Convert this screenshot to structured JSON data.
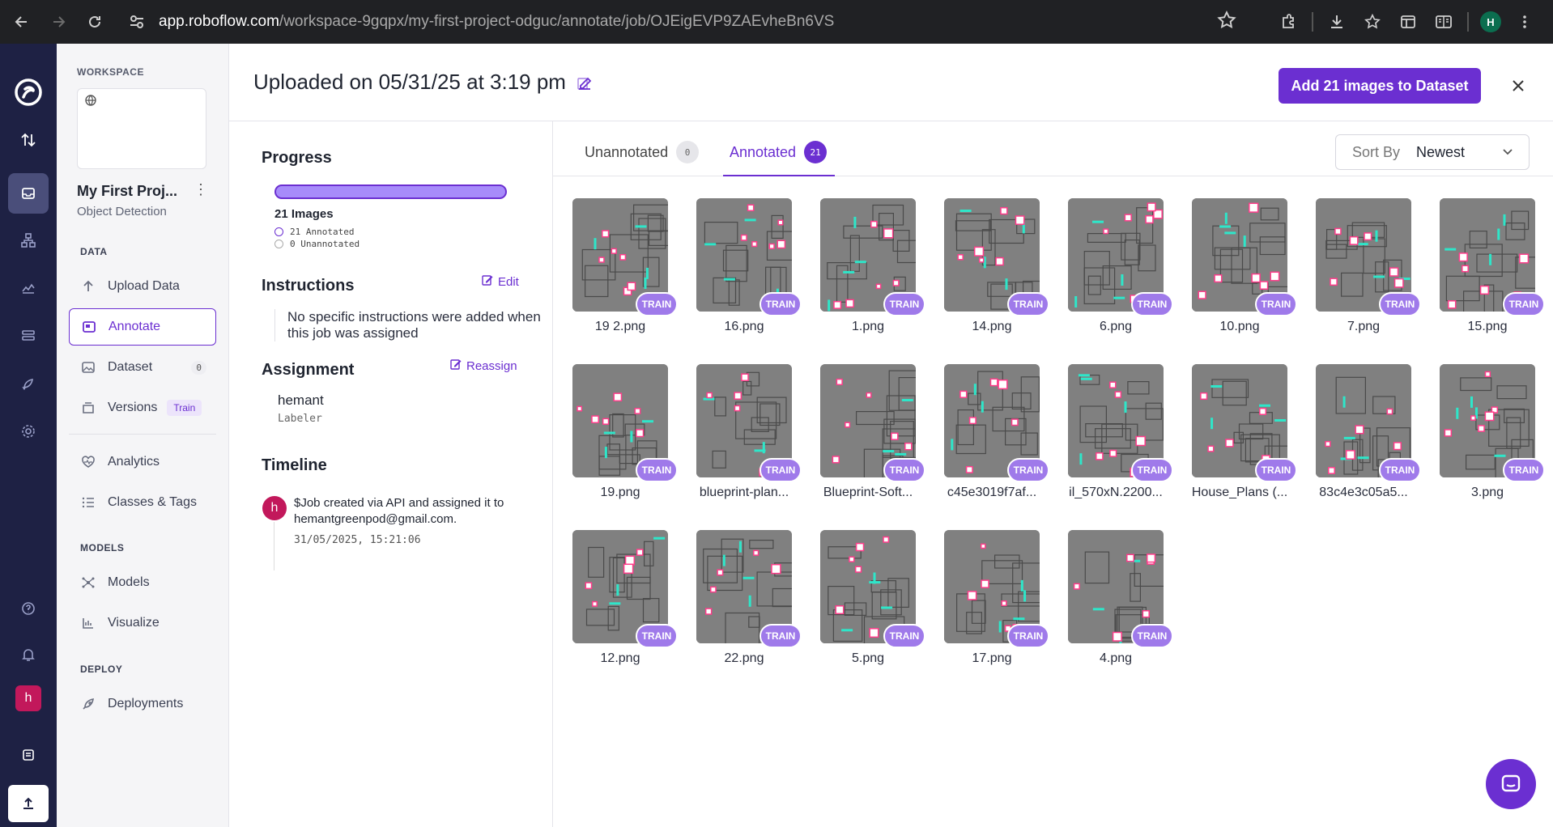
{
  "browser": {
    "url_host": "app.roboflow.com",
    "url_path": "/workspace-9gqpx/my-first-project-odguc/annotate/job/OJEigEVP9ZAEvheBn6VS",
    "profile_initial": "H"
  },
  "rail": {
    "user_initial": "h"
  },
  "sidebar": {
    "workspace_label": "WORKSPACE",
    "project_name": "My First Proj...",
    "project_type": "Object Detection",
    "data_section": "DATA",
    "items": [
      {
        "label": "Upload Data",
        "icon": "arrow-up-icon"
      },
      {
        "label": "Annotate",
        "icon": "annotate-icon"
      },
      {
        "label": "Dataset",
        "icon": "image-icon",
        "badge": "0"
      },
      {
        "label": "Versions",
        "icon": "versions-icon",
        "badge": "Train"
      },
      {
        "label": "Analytics",
        "icon": "heart-pulse-icon"
      },
      {
        "label": "Classes & Tags",
        "icon": "list-icon"
      }
    ],
    "models_section": "MODELS",
    "model_items": [
      {
        "label": "Models",
        "icon": "models-icon"
      },
      {
        "label": "Visualize",
        "icon": "chart-icon"
      }
    ],
    "deploy_section": "DEPLOY",
    "deploy_items": [
      {
        "label": "Deployments",
        "icon": "rocket-icon"
      }
    ]
  },
  "header": {
    "title": "Uploaded on 05/31/25 at 3:19 pm",
    "add_button": "Add 21 images to Dataset"
  },
  "job": {
    "progress_heading": "Progress",
    "progress_fraction": 1.0,
    "images_count": "21 Images",
    "annotated_legend": "21 Annotated",
    "unannotated_legend": "0 Unannotated",
    "instructions_heading": "Instructions",
    "edit_link": "Edit",
    "instructions_text": "No specific instructions were added when this job was assigned",
    "assignment_heading": "Assignment",
    "reassign_link": "Reassign",
    "assignee": "hemant",
    "role": "Labeler",
    "timeline_heading": "Timeline",
    "timeline_avatar": "h",
    "timeline_text": "$Job created via API and assigned it to hemantgreenpod@gmail.com.",
    "timeline_time": "31/05/2025, 15:21:06"
  },
  "tabs": [
    {
      "label": "Unannotated",
      "count": "0"
    },
    {
      "label": "Annotated",
      "count": "21"
    }
  ],
  "sort": {
    "label": "Sort By",
    "value": "Newest"
  },
  "train_label": "TRAIN",
  "images": [
    "19 2.png",
    "16.png",
    "1.png",
    "14.png",
    "6.png",
    "10.png",
    "7.png",
    "15.png",
    "19.png",
    "blueprint-plan...",
    "Blueprint-Soft...",
    "c45e3019f7af...",
    "il_570xN.2200...",
    "House_Plans (...",
    "83c4e3c05a5...",
    "3.png",
    "12.png",
    "22.png",
    "5.png",
    "17.png",
    "4.png"
  ],
  "colors": {
    "accent": "#6b2fd1",
    "rail": "#1e2144",
    "box_pink": "#ff3d8b",
    "box_teal": "#2ee6c9"
  }
}
